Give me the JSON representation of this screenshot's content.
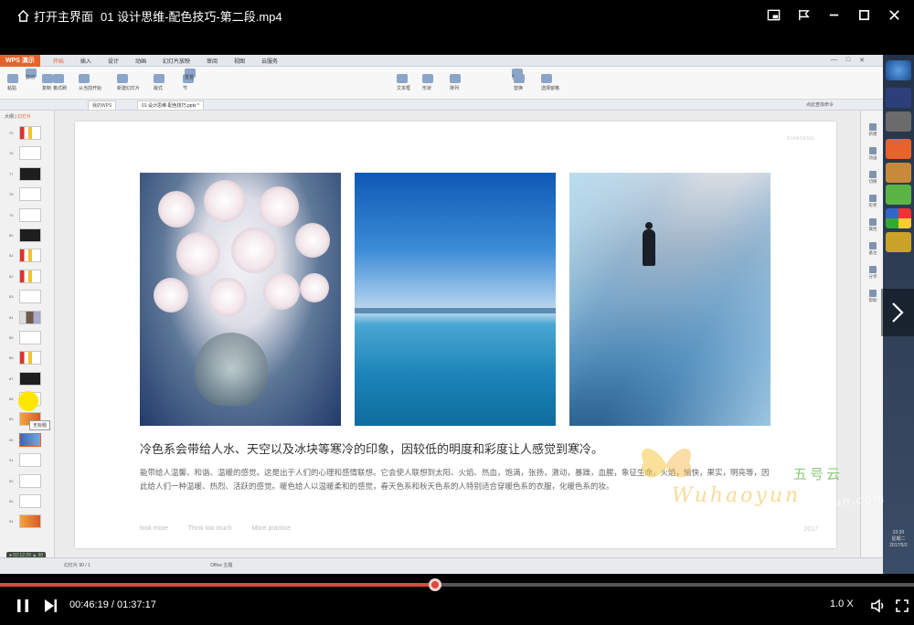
{
  "topbar": {
    "home_label": "打开主界面",
    "video_title": "01 设计思维-配色技巧-第二段.mp4"
  },
  "wps": {
    "logo": "WPS 演示",
    "tabs": [
      "开始",
      "插入",
      "设计",
      "动画",
      "幻灯片放映",
      "审阅",
      "视图",
      "云服务"
    ],
    "ribbon_labels": [
      "粘贴",
      "剪切",
      "复制",
      "格式刷",
      "从当前开始",
      "新建幻灯片",
      "版式",
      "节",
      "重置",
      "文本框",
      "形状",
      "排列",
      "查找",
      "替换",
      "选择窗格"
    ],
    "doc_tabs": [
      "我的WPS",
      "01 设计思维-配色技巧.pptx *"
    ],
    "search_hint": "点此查找命令",
    "outline_tabs": [
      "大纲",
      "幻灯片"
    ],
    "thumb_numbers": [
      "75",
      "76",
      "77",
      "78",
      "79",
      "80",
      "81",
      "82",
      "83",
      "84",
      "85",
      "86",
      "87",
      "88",
      "89",
      "90",
      "91",
      "92",
      "93",
      "94"
    ],
    "tooltip": "无标题",
    "timer": "02:12:29",
    "timer_count": "90",
    "status_left": "幻灯片 90 / 1",
    "status_mid": "Office 主题",
    "right_panel": [
      "新建",
      "动画",
      "切换",
      "形状",
      "属性",
      "备注",
      "分享",
      "帮助"
    ]
  },
  "slide": {
    "watermark": "DIANSANG",
    "title": "冷色系会带给人水、天空以及冰块等寒冷的印象，因较低的明度和彩度让人感觉到寒冷。",
    "body": "能带给人温馨、和谐、温暖的感觉。这是出于人们的心理和感情联想。它会使人联想到太阳、火焰、热血，饱满，张扬，激动，暴躁，血腥，象征生命，火焰，愉快，果实，明亮等，因此给人们一种温暖、热烈、活跃的感觉。暖色给人以温暖柔和的感觉，春天色系和秋天色系的人特别适合穿暖色系的衣服，化暖色系的妆。",
    "footer": [
      "look more",
      "Think too much",
      "More practice"
    ],
    "year": "2017"
  },
  "clock": {
    "time": "22:30",
    "label": "星期二",
    "date": "2017/5/2"
  },
  "watermark": {
    "brand": "Wuhaoyun",
    "cn": "五号云",
    "url": "https://www.wuhaoyun.com"
  },
  "player": {
    "current_time": "00:46:19",
    "total_time": "01:37:17",
    "time_display": "00:46:19 / 01:37:17",
    "speed": "1.0 X",
    "progress": 0.476
  },
  "colors": {
    "accent": "#e2453c",
    "wps_orange": "#e8632b"
  }
}
